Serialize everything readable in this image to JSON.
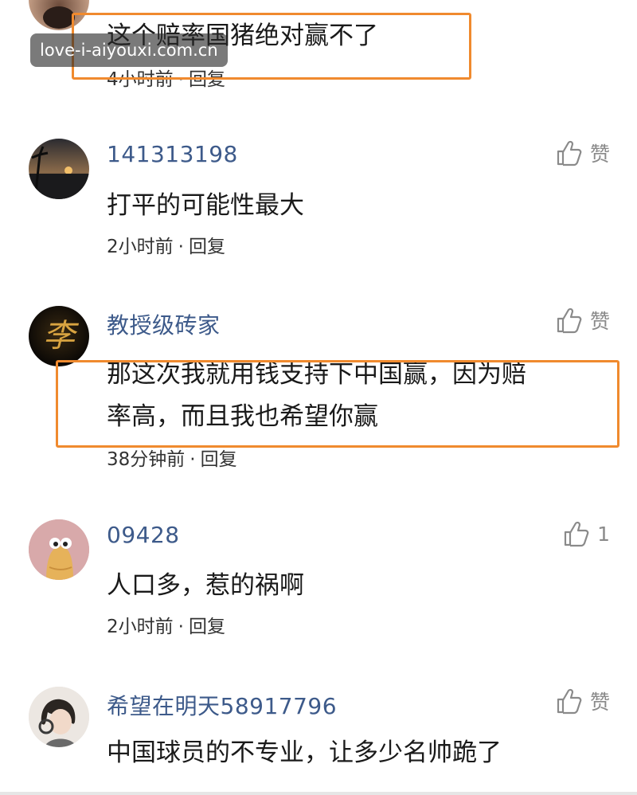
{
  "like_label": "赞",
  "colors": {
    "username": "#3d5a8a",
    "highlight": "#f08a2e",
    "watermark_bg": "#3a3a3a"
  },
  "watermark": "love-i-aiyouxi.com.cn",
  "comments": [
    {
      "text": "这个赔率国猪绝对赢不了",
      "time": "4小时前",
      "reply": "回复",
      "highlighted": true
    },
    {
      "username": "141313198",
      "text": "打平的可能性最大",
      "time": "2小时前",
      "reply": "回复",
      "likes": "赞"
    },
    {
      "username": "教授级砖家",
      "avatar_text": "李",
      "text_lines": [
        "那这次我就用钱支持下中国赢，因为赔",
        "率高，而且我也希望你赢"
      ],
      "time": "38分钟前",
      "reply": "回复",
      "likes": "赞",
      "highlighted": true
    },
    {
      "username": "09428",
      "text": "人口多，惹的祸啊",
      "time": "2小时前",
      "reply": "回复",
      "likes": "1"
    },
    {
      "username": "希望在明天58917796",
      "text": "中国球员的不专业，让多少名帅跪了",
      "likes": "赞"
    }
  ]
}
